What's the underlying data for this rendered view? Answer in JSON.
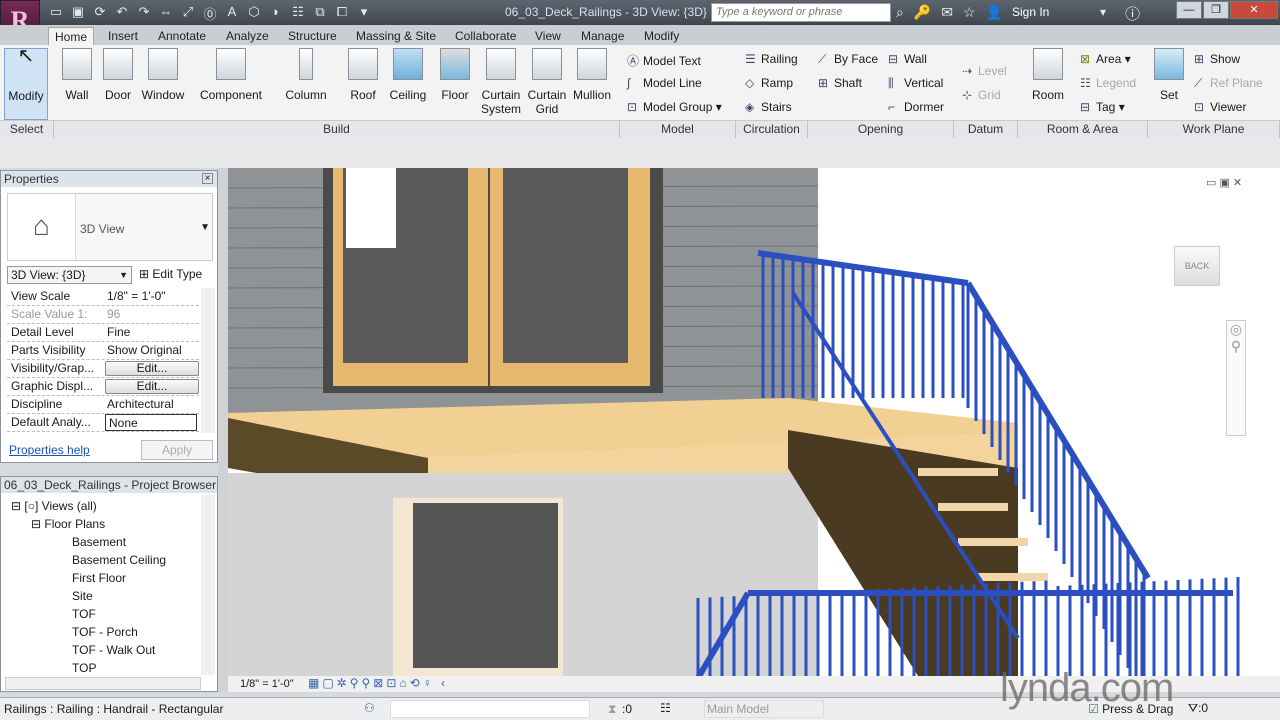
{
  "app": {
    "logo_letter": "R",
    "doc_title": "06_03_Deck_Railings - 3D View: {3D}",
    "search_placeholder": "Type a keyword or phrase",
    "sign_in": "Sign In"
  },
  "tabs": [
    "Home",
    "Insert",
    "Annotate",
    "Analyze",
    "Structure",
    "Massing & Site",
    "Collaborate",
    "View",
    "Manage",
    "Modify"
  ],
  "ribbon": {
    "select": {
      "modify": "Modify",
      "label": "Select"
    },
    "build": {
      "buttons": [
        "Wall",
        "Door",
        "Window",
        "Component",
        "Column",
        "Roof",
        "Ceiling",
        "Floor",
        "Curtain System",
        "Curtain Grid",
        "Mullion"
      ],
      "label": "Build"
    },
    "model": {
      "items": [
        "Model Text",
        "Model Line",
        "Model Group"
      ],
      "label": "Model"
    },
    "circulation": {
      "items": [
        "Railing",
        "Ramp",
        "Stairs"
      ],
      "label": "Circulation"
    },
    "opening": {
      "items": [
        "By Face",
        "Shaft",
        "Wall",
        "Vertical",
        "Dormer"
      ],
      "label": "Opening"
    },
    "datum": {
      "items": [
        "Level",
        "Grid"
      ],
      "label": "Datum"
    },
    "room_area": {
      "room": "Room",
      "items": [
        "Area",
        "Legend",
        "Tag"
      ],
      "label": "Room & Area"
    },
    "work_plane": {
      "set": "Set",
      "items": [
        "Show",
        "Ref Plane",
        "Viewer"
      ],
      "label": "Work Plane"
    }
  },
  "properties": {
    "title": "Properties",
    "type_name": "3D View",
    "selector": "3D View: {3D}",
    "edit_type": "Edit Type",
    "rows": [
      {
        "key": "View Scale",
        "value": "1/8\" = 1'-0\""
      },
      {
        "key": "Scale Value    1:",
        "value": "96"
      },
      {
        "key": "Detail Level",
        "value": "Fine"
      },
      {
        "key": "Parts Visibility",
        "value": "Show Original"
      },
      {
        "key": "Visibility/Grap...",
        "value": "Edit..."
      },
      {
        "key": "Graphic Displ...",
        "value": "Edit..."
      },
      {
        "key": "Discipline",
        "value": "Architectural"
      },
      {
        "key": "Default Analy...",
        "value": "None"
      }
    ],
    "help": "Properties help",
    "apply": "Apply"
  },
  "browser": {
    "title": "06_03_Deck_Railings - Project Browser",
    "root": "Views (all)",
    "group": "Floor Plans",
    "items": [
      "Basement",
      "Basement Ceiling",
      "First Floor",
      "Site",
      "TOF",
      "TOF - Porch",
      "TOF - Walk Out",
      "TOP"
    ]
  },
  "view": {
    "scale": "1/8\" = 1'-0\"",
    "viewcube": "BACK",
    "rail_color": "#2b4fc0"
  },
  "status": {
    "text": "Railings : Railing : Handrail - Rectangular",
    "worksets": ":0",
    "model": "Main Model",
    "press_drag": "Press & Drag",
    "filter": ":0",
    "watermark": "lynda.com"
  }
}
